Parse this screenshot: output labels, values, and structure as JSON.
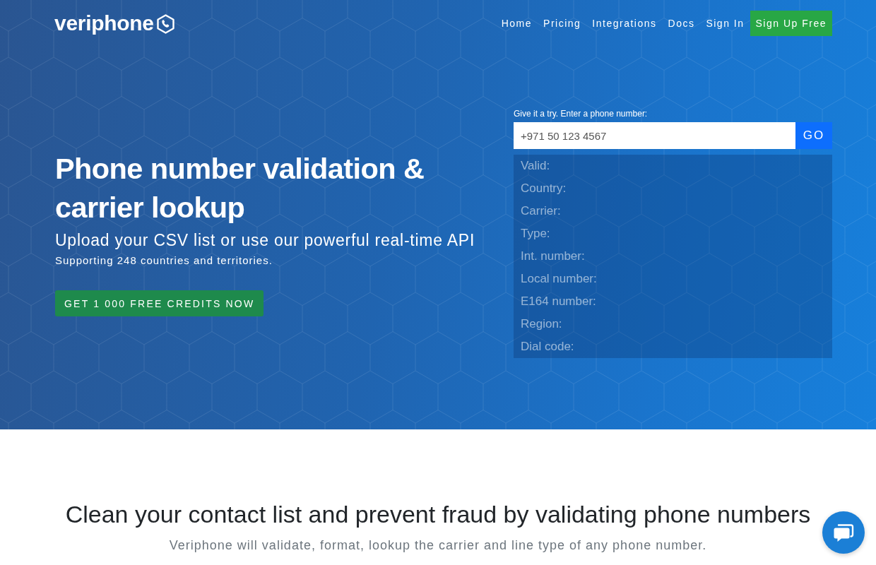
{
  "header": {
    "logo": "veriphone",
    "nav": [
      "Home",
      "Pricing",
      "Integrations",
      "Docs",
      "Sign In"
    ],
    "signup_button": "Sign Up Free"
  },
  "hero": {
    "title": "Phone number validation & carrier lookup",
    "subtitle": "Upload your CSV list or use our powerful real-time API",
    "note": "Supporting 248 countries and territories.",
    "cta_button": "GET 1 000 FREE CREDITS NOW"
  },
  "lookup": {
    "label": "Give it a try. Enter a phone number:",
    "input": {
      "placeholder": "+971 50 123 4567"
    },
    "button": "GO",
    "results": [
      "Valid:",
      "Country:",
      "Carrier:",
      "Type:",
      "Int. number:",
      "Local number:",
      "E164 number:",
      "Region:",
      "Dial code:"
    ]
  },
  "features": {
    "title": "Clean your contact list and prevent fraud by validating phone numbers",
    "subtitle": "Veriphone will validate, format, lookup the carrier and line type of any phone number."
  }
}
